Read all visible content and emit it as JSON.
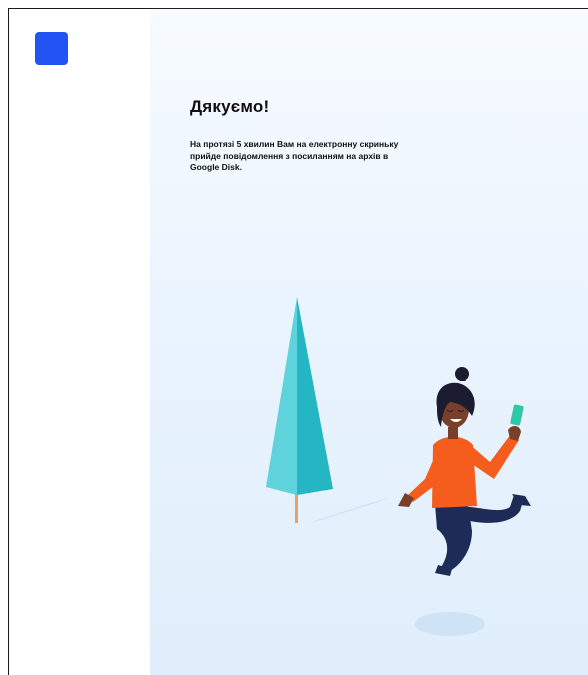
{
  "logo": {
    "color": "#2254f4"
  },
  "thank_you": {
    "title": "Дякуємо!",
    "message": "На протязі 5 хвилин Вам на електронну скриньку прийде повідомлення з посиланням на архів в Google Disk."
  },
  "illustration": {
    "subject": "woman-jumping-with-phone-and-tree",
    "colors": {
      "tree_light": "#5fd3dc",
      "tree_dark": "#24b7c3",
      "sweater": "#f45d1e",
      "pants": "#1d2b57",
      "skin": "#7a3f2b",
      "hair": "#1c1c30",
      "phone": "#2ec7a7"
    }
  }
}
